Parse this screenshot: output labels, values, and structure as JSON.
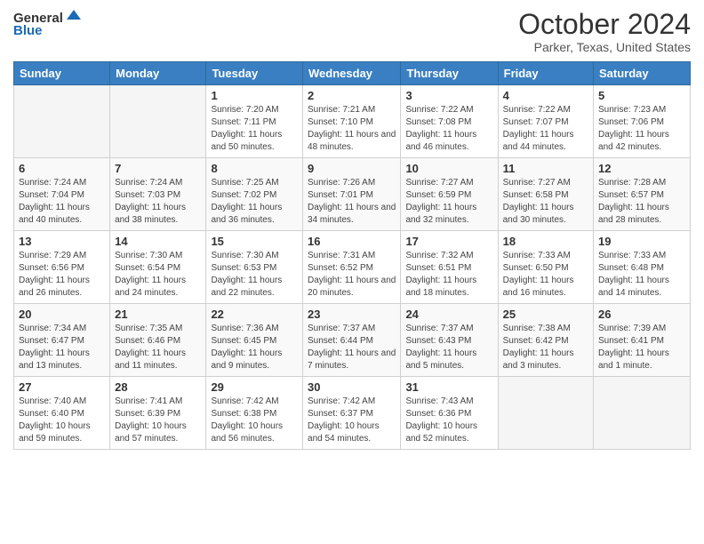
{
  "header": {
    "logo_general": "General",
    "logo_blue": "Blue",
    "title": "October 2024",
    "subtitle": "Parker, Texas, United States"
  },
  "days_of_week": [
    "Sunday",
    "Monday",
    "Tuesday",
    "Wednesday",
    "Thursday",
    "Friday",
    "Saturday"
  ],
  "weeks": [
    [
      {
        "day": "",
        "info": ""
      },
      {
        "day": "",
        "info": ""
      },
      {
        "day": "1",
        "sunrise": "7:20 AM",
        "sunset": "7:11 PM",
        "daylight": "11 hours and 50 minutes."
      },
      {
        "day": "2",
        "sunrise": "7:21 AM",
        "sunset": "7:10 PM",
        "daylight": "11 hours and 48 minutes."
      },
      {
        "day": "3",
        "sunrise": "7:22 AM",
        "sunset": "7:08 PM",
        "daylight": "11 hours and 46 minutes."
      },
      {
        "day": "4",
        "sunrise": "7:22 AM",
        "sunset": "7:07 PM",
        "daylight": "11 hours and 44 minutes."
      },
      {
        "day": "5",
        "sunrise": "7:23 AM",
        "sunset": "7:06 PM",
        "daylight": "11 hours and 42 minutes."
      }
    ],
    [
      {
        "day": "6",
        "sunrise": "7:24 AM",
        "sunset": "7:04 PM",
        "daylight": "11 hours and 40 minutes."
      },
      {
        "day": "7",
        "sunrise": "7:24 AM",
        "sunset": "7:03 PM",
        "daylight": "11 hours and 38 minutes."
      },
      {
        "day": "8",
        "sunrise": "7:25 AM",
        "sunset": "7:02 PM",
        "daylight": "11 hours and 36 minutes."
      },
      {
        "day": "9",
        "sunrise": "7:26 AM",
        "sunset": "7:01 PM",
        "daylight": "11 hours and 34 minutes."
      },
      {
        "day": "10",
        "sunrise": "7:27 AM",
        "sunset": "6:59 PM",
        "daylight": "11 hours and 32 minutes."
      },
      {
        "day": "11",
        "sunrise": "7:27 AM",
        "sunset": "6:58 PM",
        "daylight": "11 hours and 30 minutes."
      },
      {
        "day": "12",
        "sunrise": "7:28 AM",
        "sunset": "6:57 PM",
        "daylight": "11 hours and 28 minutes."
      }
    ],
    [
      {
        "day": "13",
        "sunrise": "7:29 AM",
        "sunset": "6:56 PM",
        "daylight": "11 hours and 26 minutes."
      },
      {
        "day": "14",
        "sunrise": "7:30 AM",
        "sunset": "6:54 PM",
        "daylight": "11 hours and 24 minutes."
      },
      {
        "day": "15",
        "sunrise": "7:30 AM",
        "sunset": "6:53 PM",
        "daylight": "11 hours and 22 minutes."
      },
      {
        "day": "16",
        "sunrise": "7:31 AM",
        "sunset": "6:52 PM",
        "daylight": "11 hours and 20 minutes."
      },
      {
        "day": "17",
        "sunrise": "7:32 AM",
        "sunset": "6:51 PM",
        "daylight": "11 hours and 18 minutes."
      },
      {
        "day": "18",
        "sunrise": "7:33 AM",
        "sunset": "6:50 PM",
        "daylight": "11 hours and 16 minutes."
      },
      {
        "day": "19",
        "sunrise": "7:33 AM",
        "sunset": "6:48 PM",
        "daylight": "11 hours and 14 minutes."
      }
    ],
    [
      {
        "day": "20",
        "sunrise": "7:34 AM",
        "sunset": "6:47 PM",
        "daylight": "11 hours and 13 minutes."
      },
      {
        "day": "21",
        "sunrise": "7:35 AM",
        "sunset": "6:46 PM",
        "daylight": "11 hours and 11 minutes."
      },
      {
        "day": "22",
        "sunrise": "7:36 AM",
        "sunset": "6:45 PM",
        "daylight": "11 hours and 9 minutes."
      },
      {
        "day": "23",
        "sunrise": "7:37 AM",
        "sunset": "6:44 PM",
        "daylight": "11 hours and 7 minutes."
      },
      {
        "day": "24",
        "sunrise": "7:37 AM",
        "sunset": "6:43 PM",
        "daylight": "11 hours and 5 minutes."
      },
      {
        "day": "25",
        "sunrise": "7:38 AM",
        "sunset": "6:42 PM",
        "daylight": "11 hours and 3 minutes."
      },
      {
        "day": "26",
        "sunrise": "7:39 AM",
        "sunset": "6:41 PM",
        "daylight": "11 hours and 1 minute."
      }
    ],
    [
      {
        "day": "27",
        "sunrise": "7:40 AM",
        "sunset": "6:40 PM",
        "daylight": "10 hours and 59 minutes."
      },
      {
        "day": "28",
        "sunrise": "7:41 AM",
        "sunset": "6:39 PM",
        "daylight": "10 hours and 57 minutes."
      },
      {
        "day": "29",
        "sunrise": "7:42 AM",
        "sunset": "6:38 PM",
        "daylight": "10 hours and 56 minutes."
      },
      {
        "day": "30",
        "sunrise": "7:42 AM",
        "sunset": "6:37 PM",
        "daylight": "10 hours and 54 minutes."
      },
      {
        "day": "31",
        "sunrise": "7:43 AM",
        "sunset": "6:36 PM",
        "daylight": "10 hours and 52 minutes."
      },
      {
        "day": "",
        "info": ""
      },
      {
        "day": "",
        "info": ""
      }
    ]
  ]
}
